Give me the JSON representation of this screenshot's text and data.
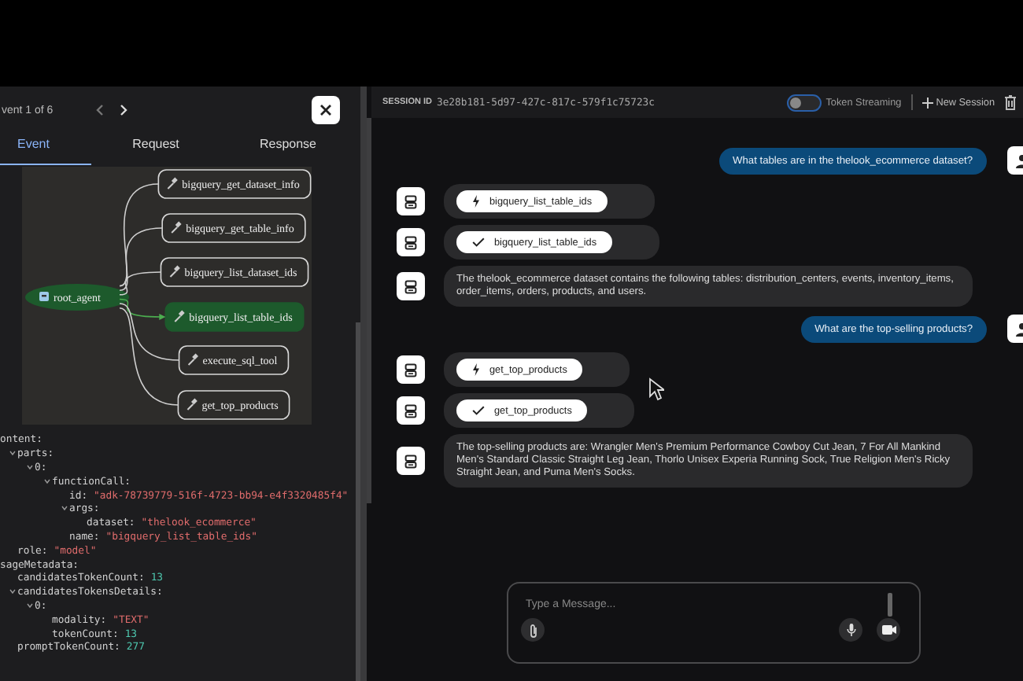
{
  "event_panel": {
    "counter": "vent 1 of 6",
    "tabs": [
      {
        "label": "Event",
        "selected": true
      },
      {
        "label": "Request",
        "selected": false
      },
      {
        "label": "Response",
        "selected": false
      }
    ],
    "graph": {
      "root": {
        "label": "root_agent"
      },
      "tools": [
        {
          "label": "bigquery_get_dataset_info",
          "selected": false
        },
        {
          "label": "bigquery_get_table_info",
          "selected": false
        },
        {
          "label": "bigquery_list_dataset_ids",
          "selected": false
        },
        {
          "label": "bigquery_list_table_ids",
          "selected": true
        },
        {
          "label": "execute_sql_tool",
          "selected": false
        },
        {
          "label": "get_top_products",
          "selected": false
        }
      ]
    },
    "tree": [
      {
        "key": "ontent:",
        "children": [
          {
            "key": "parts:",
            "expanded": true,
            "children": [
              {
                "key": "0:",
                "expanded": true,
                "children": [
                  {
                    "key": "functionCall:",
                    "expanded": true,
                    "children": [
                      {
                        "key": "id:",
                        "value": "\"adk-78739779-516f-4723-bb94-e4f3320485f4\"",
                        "kind": "string"
                      },
                      {
                        "key": "args:",
                        "expanded": true,
                        "children": [
                          {
                            "key": "dataset:",
                            "value": "\"thelook_ecommerce\"",
                            "kind": "string"
                          }
                        ]
                      },
                      {
                        "key": "name:",
                        "value": "\"bigquery_list_table_ids\"",
                        "kind": "string"
                      }
                    ]
                  }
                ]
              }
            ]
          },
          {
            "key": "role:",
            "value": "\"model\"",
            "kind": "string"
          }
        ]
      },
      {
        "key": "sageMetadata:",
        "children": [
          {
            "key": "candidatesTokenCount:",
            "value": "13",
            "kind": "number"
          },
          {
            "key": "candidatesTokensDetails:",
            "expanded": true,
            "children": [
              {
                "key": "0:",
                "expanded": true,
                "children": [
                  {
                    "key": "modality:",
                    "value": "\"TEXT\"",
                    "kind": "string"
                  },
                  {
                    "key": "tokenCount:",
                    "value": "13",
                    "kind": "number"
                  }
                ]
              }
            ]
          },
          {
            "key": "promptTokenCount:",
            "value": "277",
            "kind": "number"
          }
        ]
      }
    ]
  },
  "session": {
    "label": "SESSION ID",
    "id": "3e28b181-5d97-427c-817c-579f1c75723c",
    "token_streaming": {
      "label": "Token Streaming",
      "on": false
    },
    "new_session": "New Session"
  },
  "messages": [
    {
      "kind": "user",
      "text": "What tables are in the thelook_ecommerce dataset?"
    },
    {
      "kind": "call",
      "text": "bigquery_list_table_ids"
    },
    {
      "kind": "result",
      "text": "bigquery_list_table_ids"
    },
    {
      "kind": "bot",
      "text": "The thelook_ecommerce dataset contains the following tables: distribution_centers, events, inventory_items, order_items, orders, products, and users."
    },
    {
      "kind": "user",
      "text": "What are the top-selling products?"
    },
    {
      "kind": "call",
      "text": "get_top_products"
    },
    {
      "kind": "result",
      "text": "get_top_products"
    },
    {
      "kind": "bot",
      "text": "The top-selling products are: Wrangler Men's Premium Performance Cowboy Cut Jean, 7 For All Mankind Men's Standard Classic Straight Leg Jean, Thorlo Unisex Experia Running Sock, True Religion Men's Ricky Straight Jean, and Puma Men's Socks."
    }
  ],
  "composer": {
    "placeholder": "Type a Message..."
  }
}
